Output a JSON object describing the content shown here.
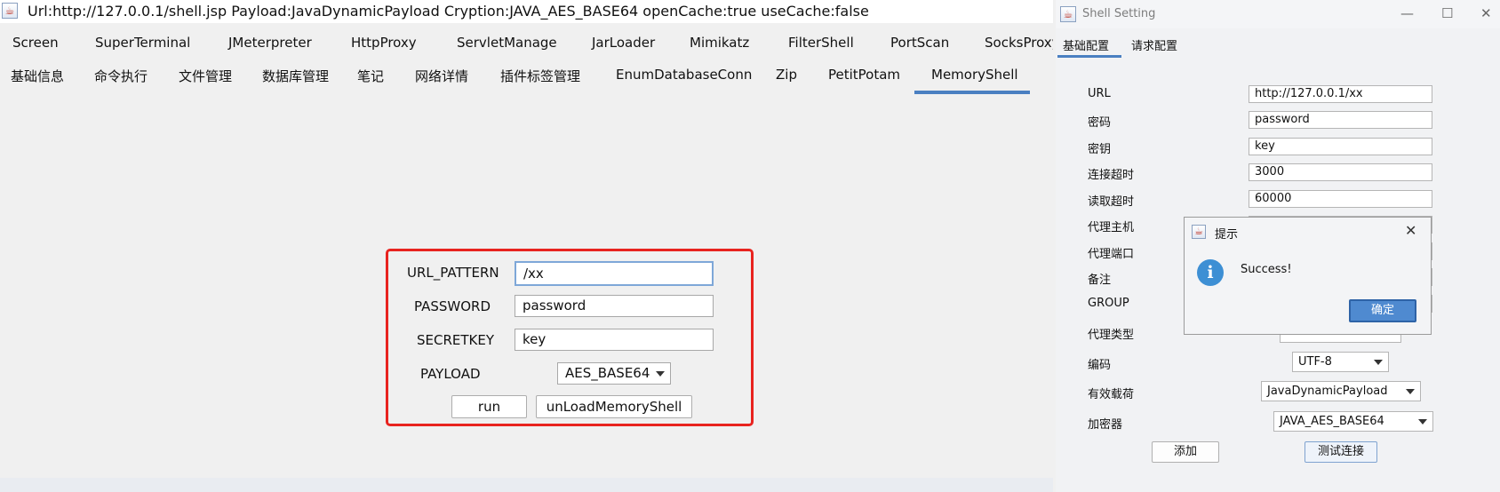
{
  "main_window": {
    "title": "Url:http://127.0.0.1/shell.jsp Payload:JavaDynamicPayload Cryption:JAVA_AES_BASE64 openCache:true useCache:false",
    "plugin_tabs": [
      "Screen",
      "SuperTerminal",
      "JMeterpreter",
      "HttpProxy",
      "ServletManage",
      "JarLoader",
      "Mimikatz",
      "FilterShell",
      "PortScan",
      "SocksProxy"
    ],
    "module_tabs": [
      "基础信息",
      "命令执行",
      "文件管理",
      "数据库管理",
      "笔记",
      "网络详情",
      "插件标签管理",
      "EnumDatabaseConn",
      "Zip",
      "PetitPotam",
      "MemoryShell"
    ],
    "active_module_tab": "MemoryShell"
  },
  "memory_shell": {
    "url_pattern_label": "URL_PATTERN",
    "url_pattern_value": "/xx",
    "password_label": "PASSWORD",
    "password_value": "password",
    "secretkey_label": "SECRETKEY",
    "secretkey_value": "key",
    "payload_label": "PAYLOAD",
    "payload_value": "AES_BASE64",
    "run_button": "run",
    "unload_button": "unLoadMemoryShell"
  },
  "shell_setting": {
    "title": "Shell Setting",
    "tabs": [
      "基础配置",
      "请求配置"
    ],
    "fields": {
      "url": {
        "label": "URL",
        "value": "http://127.0.0.1/xx"
      },
      "password": {
        "label": "密码",
        "value": "password"
      },
      "key": {
        "label": "密钥",
        "value": "key"
      },
      "conn_timeout": {
        "label": "连接超时",
        "value": "3000"
      },
      "read_timeout": {
        "label": "读取超时",
        "value": "60000"
      },
      "proxy_host": {
        "label": "代理主机"
      },
      "proxy_port": {
        "label": "代理端口"
      },
      "remark": {
        "label": "备注"
      },
      "group": {
        "label": "GROUP"
      },
      "proxy_type": {
        "label": "代理类型"
      },
      "encoding": {
        "label": "编码",
        "value": "UTF-8"
      },
      "payload": {
        "label": "有效载荷",
        "value": "JavaDynamicPayload"
      },
      "cryption": {
        "label": "加密器",
        "value": "JAVA_AES_BASE64"
      }
    },
    "add_button": "添加",
    "test_button": "测试连接"
  },
  "dialog": {
    "title": "提示",
    "message": "Success!",
    "ok_button": "确定"
  }
}
